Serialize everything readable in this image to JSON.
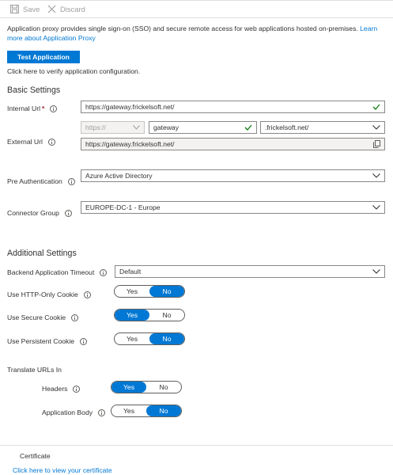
{
  "toolbar": {
    "save_label": "Save",
    "discard_label": "Discard"
  },
  "intro": {
    "text": "Application proxy provides single sign-on (SSO) and secure remote access for web applications hosted on-premises.",
    "link": "Learn more about Application Proxy"
  },
  "test": {
    "button_label": "Test Application",
    "hint": "Click here to verify application configuration."
  },
  "basic": {
    "title": "Basic Settings",
    "internal_url_label": "Internal Url",
    "internal_url_required": "*",
    "internal_url_value": "https://gateway.frickelsoft.net/",
    "external_url_label": "External Url",
    "external_scheme": "https://",
    "external_subdomain": "gateway",
    "external_domain": ".frickelsoft.net/",
    "external_full": "https://gateway.frickelsoft.net/",
    "pre_auth_label": "Pre Authentication",
    "pre_auth_value": "Azure Active Directory",
    "connector_label": "Connector Group",
    "connector_value": "EUROPE-DC-1 - Europe"
  },
  "additional": {
    "title": "Additional Settings",
    "timeout_label": "Backend Application Timeout",
    "timeout_value": "Default",
    "http_only_label": "Use HTTP-Only Cookie",
    "secure_label": "Use Secure Cookie",
    "persistent_label": "Use Persistent Cookie",
    "translate_label": "Translate URLs In",
    "headers_label": "Headers",
    "body_label": "Application Body",
    "yes": "Yes",
    "no": "No"
  },
  "certificate": {
    "title": "Certificate",
    "link": "Click here to view your certificate"
  },
  "colors": {
    "accent": "#0078d4",
    "valid": "#107c10",
    "required": "#a4262c"
  }
}
